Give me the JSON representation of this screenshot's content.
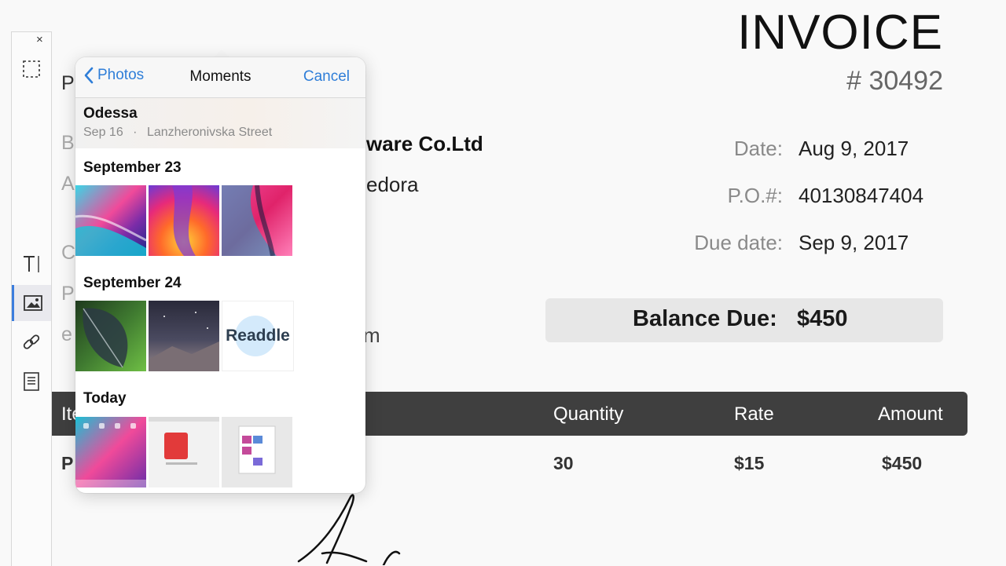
{
  "invoice": {
    "title": "INVOICE",
    "number": "# 30492",
    "date_label": "Date:",
    "date_value": "Aug 9, 2017",
    "po_label": "P.O.#:",
    "po_value": "40130847404",
    "due_label": "Due date:",
    "due_value": "Sep 9, 2017",
    "balance_label": "Balance Due:",
    "balance_value": "$450",
    "company_fragment": "ware Co.Ltd",
    "city_fragment": "edora",
    "email_fragment": "m",
    "left_fragments": [
      "P",
      "B",
      "A",
      "C",
      "P",
      "e"
    ],
    "table": {
      "headers": [
        "Ite",
        "Quantity",
        "Rate",
        "Amount"
      ],
      "row": {
        "item_fragment": "P",
        "quantity": "30",
        "rate": "$15",
        "amount": "$450"
      }
    }
  },
  "toolbar": {
    "close_label": "×",
    "tools": [
      "selection-icon",
      "text-icon",
      "image-icon",
      "link-icon",
      "note-icon"
    ],
    "active_tool": "image-icon"
  },
  "picker": {
    "back_label": "Photos",
    "title": "Moments",
    "cancel_label": "Cancel",
    "moment": {
      "name": "Odessa",
      "date": "Sep 16",
      "place": "Lanzheronivska Street"
    },
    "sections": [
      {
        "title": "September 23",
        "thumbs": 3
      },
      {
        "title": "September 24",
        "thumbs": 3,
        "logo_text": "Readdle"
      },
      {
        "title": "Today",
        "thumbs": 3
      }
    ]
  },
  "colors": {
    "accent": "#2f7ed8",
    "header_bar": "#3f3f3f",
    "balance_bg": "#e7e7e7"
  }
}
